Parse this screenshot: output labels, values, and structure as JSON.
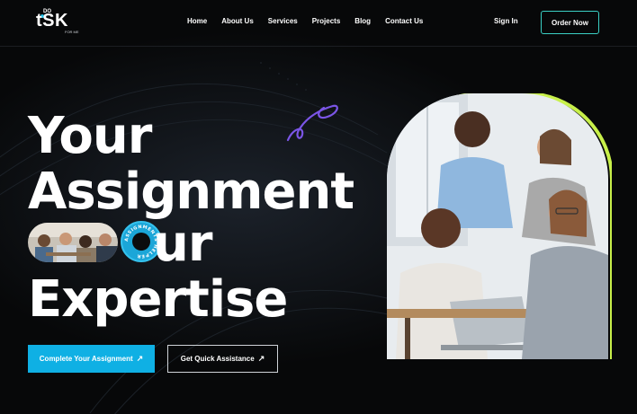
{
  "brand": {
    "logo_main": "tSK",
    "logo_prefix": "DO",
    "logo_sub": "FOR ME",
    "accent": "#0fb0e4",
    "lime": "#c8f04a"
  },
  "nav": {
    "items": [
      {
        "label": "Home"
      },
      {
        "label": "About Us"
      },
      {
        "label": "Services"
      },
      {
        "label": "Projects"
      },
      {
        "label": "Blog"
      },
      {
        "label": "Contact Us"
      }
    ],
    "signin_label": "Sign In",
    "order_label": "Order Now"
  },
  "hero": {
    "line1": "Your",
    "line2": "Assignment",
    "line3": "ur",
    "line4": "Expertise",
    "badge_text": "ASSIGNMENTS HELPER",
    "cta_primary": "Complete Your Assignment",
    "cta_secondary": "Get Quick Assistance",
    "arrow_icon": "↗"
  }
}
